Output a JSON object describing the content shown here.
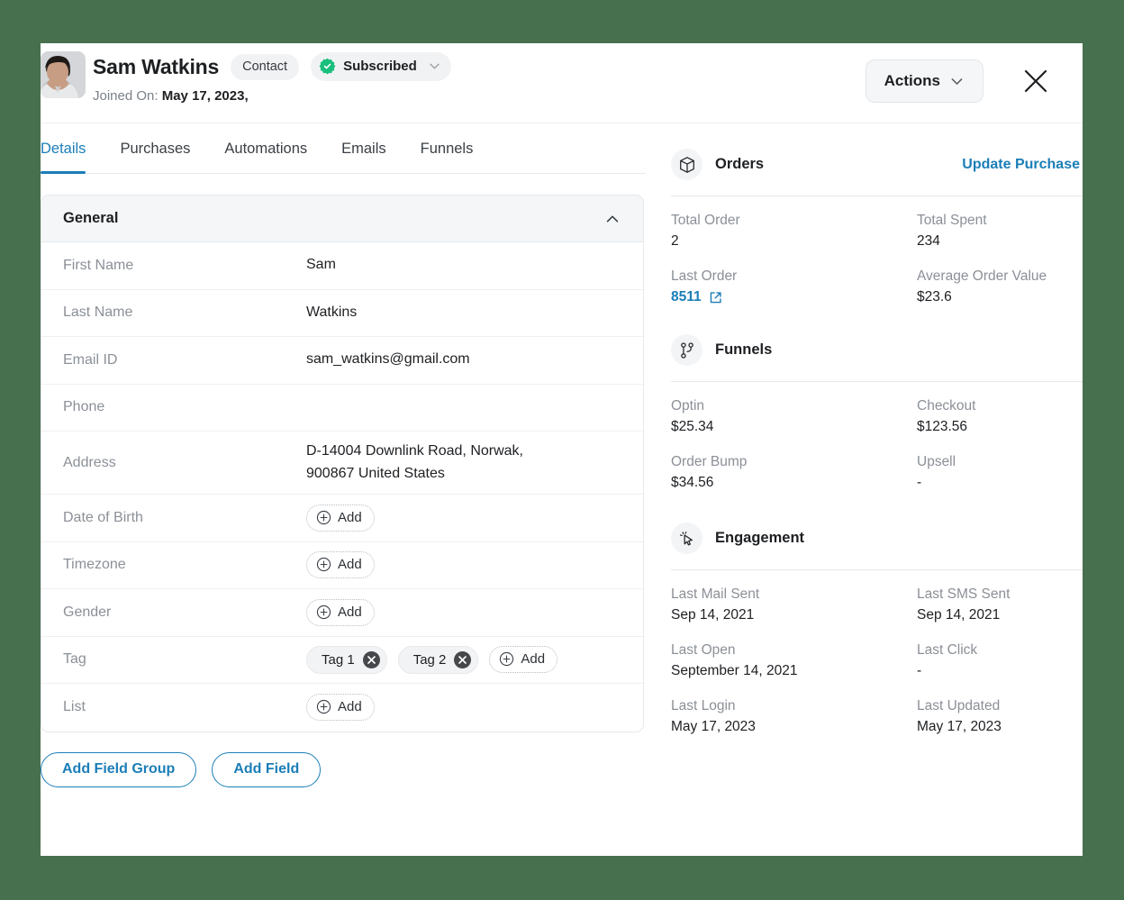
{
  "theme": {
    "page_background": "#47704e",
    "accent_blue": "#1b7eb8",
    "subscribed_green": "#19bf7c",
    "panel_white": "#ffffff"
  },
  "header": {
    "contact_name": "Sam Watkins",
    "type_badge": "Contact",
    "status_badge": "Subscribed",
    "joined_label": "Joined On:",
    "joined_value": "May 17, 2023,",
    "actions_label": "Actions",
    "close_label": "×"
  },
  "tabs": [
    {
      "label": "Details",
      "active": true
    },
    {
      "label": "Purchases",
      "active": false
    },
    {
      "label": "Automations",
      "active": false
    },
    {
      "label": "Emails",
      "active": false
    },
    {
      "label": "Funnels",
      "active": false
    }
  ],
  "general_card": {
    "title": "General",
    "rows": [
      {
        "label": "First Name",
        "value": "Sam",
        "kind": "text"
      },
      {
        "label": "Last Name",
        "value": "Watkins",
        "kind": "text"
      },
      {
        "label": "Email ID",
        "value": "sam_watkins@gmail.com",
        "kind": "text"
      },
      {
        "label": "Phone",
        "value": "",
        "kind": "text"
      },
      {
        "label": "Address",
        "value_line1": "D-14004  Downlink Road, Norwak,",
        "value_line2": "900867 United States",
        "kind": "multiline"
      },
      {
        "label": "Date of Birth",
        "add_label": "Add",
        "kind": "add"
      },
      {
        "label": "Timezone",
        "add_label": "Add",
        "kind": "add"
      },
      {
        "label": "Gender",
        "add_label": "Add",
        "kind": "add"
      },
      {
        "label": "Tag",
        "tags": [
          "Tag 1",
          "Tag 2"
        ],
        "add_label": "Add",
        "kind": "tags"
      },
      {
        "label": "List",
        "add_label": "Add",
        "kind": "add"
      }
    ]
  },
  "footer_buttons": {
    "add_field_group": "Add Field Group",
    "add_field": "Add Field"
  },
  "sidebar": {
    "orders": {
      "title": "Orders",
      "action": "Update Purchase",
      "stats": [
        {
          "key": "Total Order",
          "value": "2"
        },
        {
          "key": "Total Spent",
          "value": "234"
        },
        {
          "key": "Last Order",
          "value": "8511",
          "is_link": true
        },
        {
          "key": "Average Order Value",
          "value": "$23.6"
        }
      ]
    },
    "funnels": {
      "title": "Funnels",
      "stats": [
        {
          "key": "Optin",
          "value": "$25.34"
        },
        {
          "key": "Checkout",
          "value": "$123.56"
        },
        {
          "key": "Order Bump",
          "value": "$34.56"
        },
        {
          "key": "Upsell",
          "value": "-"
        }
      ]
    },
    "engagement": {
      "title": "Engagement",
      "stats": [
        {
          "key": "Last Mail Sent",
          "value": "Sep 14, 2021"
        },
        {
          "key": "Last SMS Sent",
          "value": "Sep 14, 2021"
        },
        {
          "key": "Last Open",
          "value": "September 14, 2021"
        },
        {
          "key": "Last Click",
          "value": "-"
        },
        {
          "key": "Last Login",
          "value": "May 17, 2023"
        },
        {
          "key": "Last Updated",
          "value": "May 17, 2023"
        }
      ]
    }
  },
  "icons": {
    "avatar": "avatar-photo",
    "verified": "verified-check-icon",
    "chevron_down": "chevron-down-icon",
    "chevron_up": "chevron-up-icon",
    "close": "close-icon",
    "plus": "plus-circle-icon",
    "tag_remove": "close-circle-icon",
    "orders": "package-box-icon",
    "funnels": "branch-nodes-icon",
    "engagement": "cursor-click-icon",
    "external": "external-link-icon"
  }
}
